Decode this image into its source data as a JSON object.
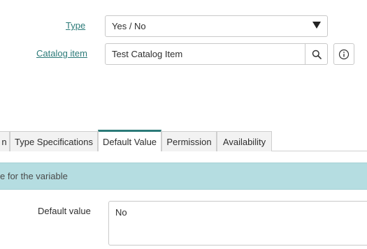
{
  "form": {
    "type_label": "Type",
    "type_value": "Yes / No",
    "catalog_item_label": "Catalog item",
    "catalog_item_value": "Test Catalog Item"
  },
  "tabs": [
    {
      "label": "n"
    },
    {
      "label": "Type Specifications"
    },
    {
      "label": "Default Value",
      "active": true
    },
    {
      "label": "Permission"
    },
    {
      "label": "Availability"
    }
  ],
  "default_value_section": {
    "banner_text": "e for the variable",
    "field_label": "Default value",
    "field_value": "No"
  },
  "icons": {
    "dropdown": "chevron-down-icon",
    "search": "search-icon",
    "info": "info-icon"
  },
  "colors": {
    "accent": "#2b7a78",
    "banner_bg": "#b5dde1",
    "tab_bg": "#f2f2f2"
  }
}
